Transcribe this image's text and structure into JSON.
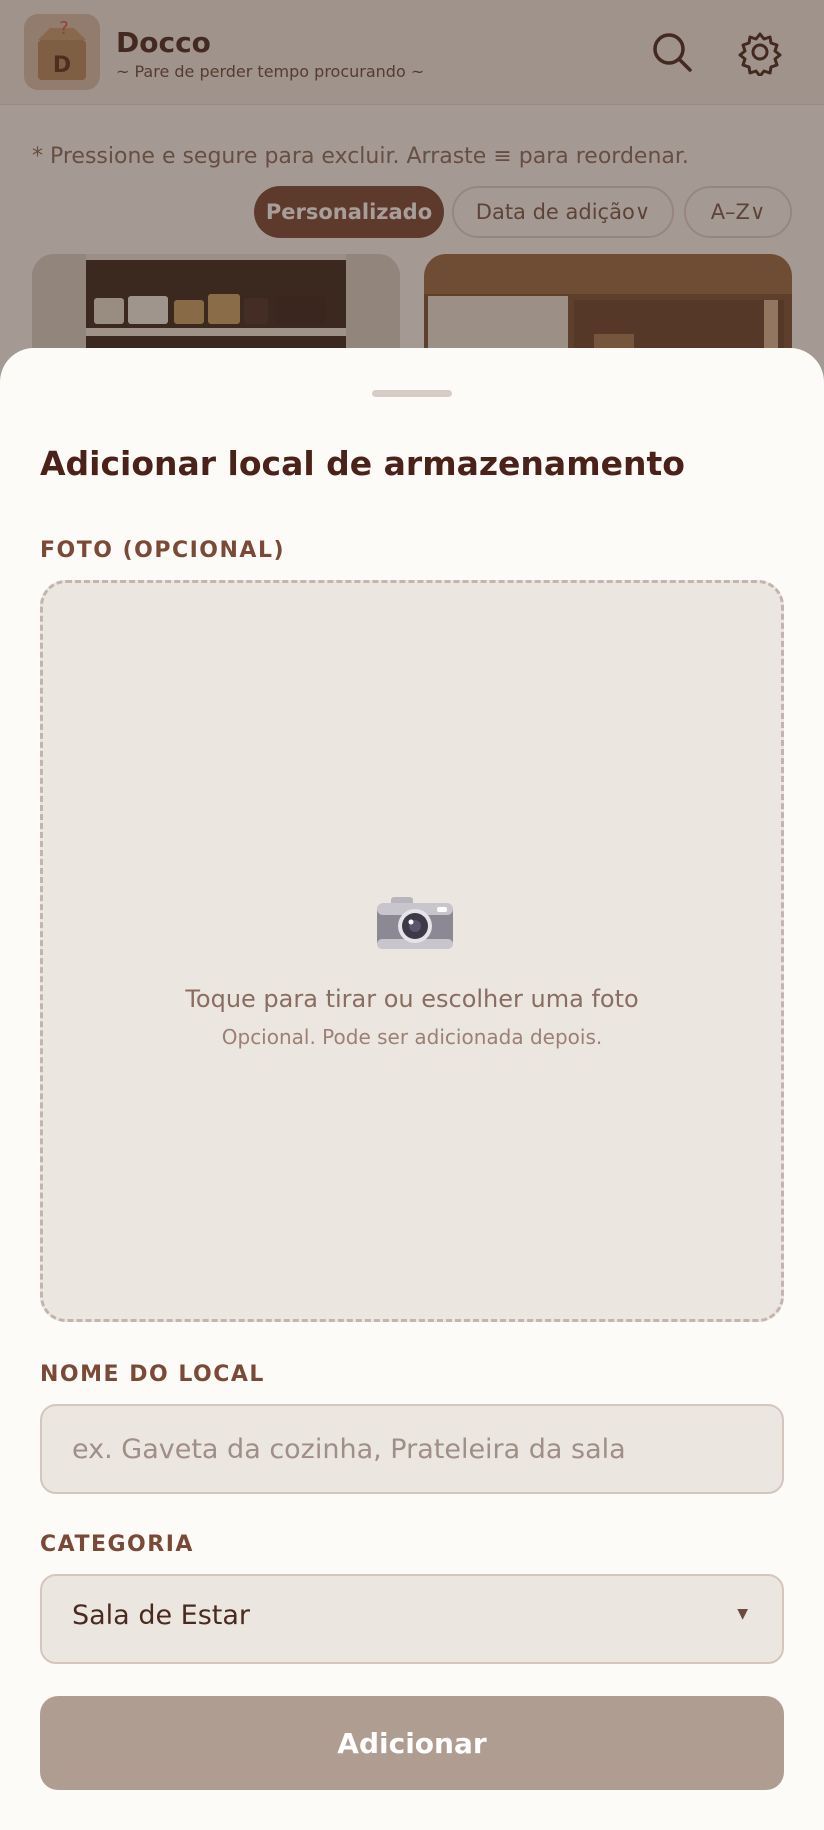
{
  "app": {
    "title": "Docco",
    "subtitle": "~ Pare de perder tempo procurando ~",
    "logo_letters": "D"
  },
  "list": {
    "hint": "* Pressione e segure para excluir. Arraste ≡ para reordenar.",
    "sort_chips": [
      {
        "label": "Personalizado",
        "active": true
      },
      {
        "label": "Data de adição∨",
        "active": false
      },
      {
        "label": "A–Z∨",
        "active": false
      }
    ]
  },
  "sheet": {
    "title": "Adicionar local de armazenamento",
    "photo_label": "FOTO (OPCIONAL)",
    "photo_main": "Toque para tirar ou escolher uma foto",
    "photo_sub": "Opcional. Pode ser adicionada depois.",
    "name_label": "NOME DO LOCAL",
    "name_placeholder": "ex. Gaveta da cozinha, Prateleira da sala",
    "name_value": "",
    "category_label": "CATEGORIA",
    "category_value": "Sala de Estar",
    "submit_label": "Adicionar"
  },
  "colors": {
    "primary": "#7a4a37",
    "button_disabled": "#b09d92",
    "sheet_bg": "#fdfbf7"
  },
  "icons": [
    "app-logo-icon",
    "search-icon",
    "gear-icon",
    "camera-icon",
    "chevron-down-icon"
  ]
}
